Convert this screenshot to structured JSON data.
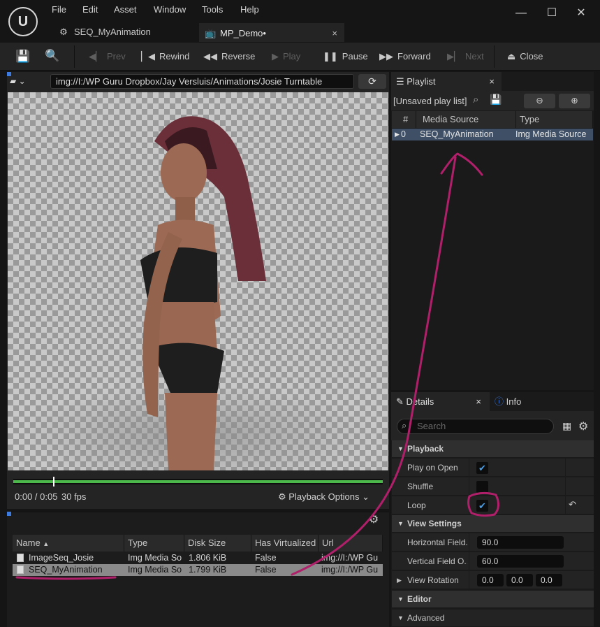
{
  "menu": [
    "File",
    "Edit",
    "Asset",
    "Window",
    "Tools",
    "Help"
  ],
  "tabs": [
    {
      "label": "SEQ_MyAnimation",
      "icon": "media-source-icon"
    },
    {
      "label": "MP_Demo•",
      "icon": "media-player-icon",
      "close": "×"
    }
  ],
  "window": {
    "minimize": "—",
    "maximize": "☐",
    "close": "✕"
  },
  "toolbar": {
    "prev": "Prev",
    "rewind": "Rewind",
    "reverse": "Reverse",
    "play": "Play",
    "pause": "Pause",
    "forward": "Forward",
    "next": "Next",
    "close": "Close"
  },
  "viewer": {
    "url": "img://I:/WP Guru Dropbox/Jay Versluis/Animations/Josie Turntable",
    "time": "0:00 / 0:05",
    "fps": "30 fps",
    "playback_options": "Playback Options",
    "progress": 0.11
  },
  "files": {
    "columns": [
      "Name",
      "Type",
      "Disk Size",
      "Has Virtualized",
      "Url"
    ],
    "rows": [
      {
        "name": "ImageSeq_Josie",
        "type": "Img Media So",
        "size": "1.806 KiB",
        "virtualized": "False",
        "url": "img://I:/WP Gu"
      },
      {
        "name": "SEQ_MyAnimation",
        "type": "Img Media So",
        "size": "1.799 KiB",
        "virtualized": "False",
        "url": "img://I:/WP Gu"
      }
    ]
  },
  "playlist": {
    "tab": "Playlist",
    "close": "×",
    "name": "[Unsaved play list]",
    "columns": [
      "#",
      "Media Source",
      "Type"
    ],
    "rows": [
      {
        "index": "0",
        "source": "SEQ_MyAnimation",
        "type": "Img Media Source"
      }
    ]
  },
  "details": {
    "tab": "Details",
    "close": "×",
    "info_tab": "Info",
    "search_placeholder": "Search",
    "playback_category": "Playback",
    "play_on_open": "Play on Open",
    "shuffle": "Shuffle",
    "loop": "Loop",
    "view_settings_category": "View Settings",
    "horizontal_fov_label": "Horizontal Field...",
    "horizontal_fov_value": "90.0",
    "vertical_fov_label": "Vertical Field O...",
    "vertical_fov_value": "60.0",
    "view_rotation_label": "View Rotation",
    "rotation": [
      "0.0",
      "0.0",
      "0.0"
    ],
    "editor_category": "Editor",
    "advanced": "Advanced",
    "play_on_open_checked": true,
    "shuffle_checked": false,
    "loop_checked": true
  },
  "colors": {
    "annotation": "#b0206a",
    "progress": "#4cb84c",
    "selection": "#3f5066"
  }
}
